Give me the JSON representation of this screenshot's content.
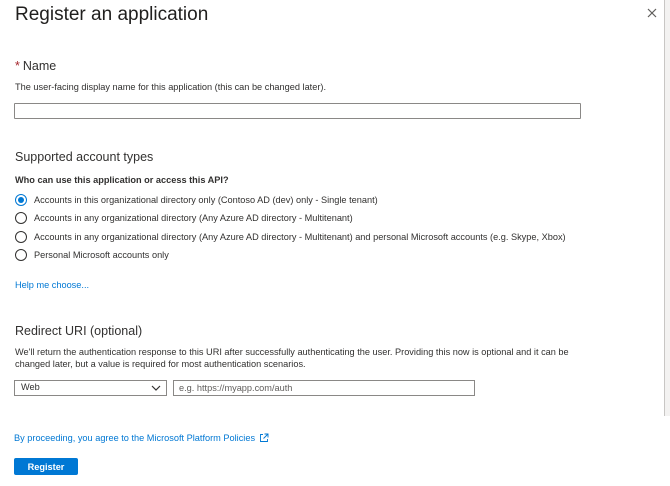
{
  "header": {
    "title": "Register an application",
    "close_icon": "close-icon"
  },
  "name_section": {
    "required_marker": "*",
    "title": "Name",
    "description": "The user-facing display name for this application (this can be changed later).",
    "value": ""
  },
  "account_types": {
    "title": "Supported account types",
    "question": "Who can use this application or access this API?",
    "options": [
      {
        "label": "Accounts in this organizational directory only (Contoso AD (dev) only - Single tenant)",
        "checked": true
      },
      {
        "label": "Accounts in any organizational directory (Any Azure AD directory - Multitenant)",
        "checked": false
      },
      {
        "label": "Accounts in any organizational directory (Any Azure AD directory - Multitenant) and personal Microsoft accounts (e.g. Skype, Xbox)",
        "checked": false
      },
      {
        "label": "Personal Microsoft accounts only",
        "checked": false
      }
    ],
    "help_link": "Help me choose..."
  },
  "redirect": {
    "title": "Redirect URI (optional)",
    "description_line1": "We'll return the authentication response to this URI after successfully authenticating the user. Providing this now is optional and it can be",
    "description_line2": "changed later, but a value is required for most authentication scenarios.",
    "platform_value": "Web",
    "uri_placeholder": "e.g. https://myapp.com/auth",
    "uri_value": ""
  },
  "footer": {
    "policy_text": "By proceeding, you agree to the Microsoft Platform Policies",
    "policy_icon": "external-link-icon",
    "register_label": "Register"
  },
  "colors": {
    "accent": "#0078d4",
    "required": "#a4262c",
    "text": "#323130"
  }
}
